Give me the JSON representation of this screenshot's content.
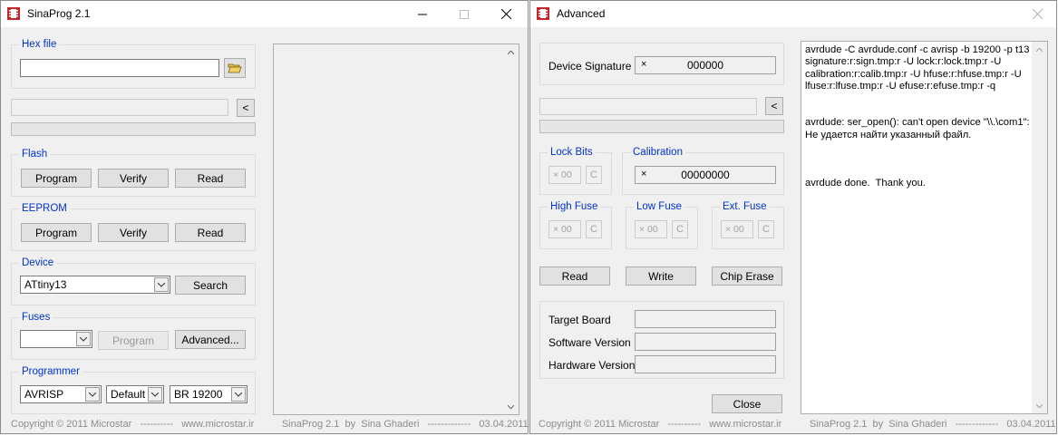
{
  "main_window": {
    "title": "SinaProg 2.1",
    "hex_file": {
      "label": "Hex file",
      "value": ""
    },
    "collapse_button": "<",
    "flash": {
      "label": "Flash",
      "program": "Program",
      "verify": "Verify",
      "read": "Read"
    },
    "eeprom": {
      "label": "EEPROM",
      "program": "Program",
      "verify": "Verify",
      "read": "Read"
    },
    "device": {
      "label": "Device",
      "selected": "ATtiny13",
      "search": "Search"
    },
    "fuses": {
      "label": "Fuses",
      "selected": "",
      "program": "Program",
      "advanced": "Advanced..."
    },
    "programmer": {
      "label": "Programmer",
      "type": "AVRISP",
      "port": "Default",
      "baud": "BR 19200"
    },
    "footer": "Copyright © 2011 Microstar   ----------   www.microstar.ir          SinaProg 2.1  by  Sina Ghaderi   -------------   03.04.2011"
  },
  "advanced_window": {
    "title": "Advanced",
    "device_signature": {
      "label": "Device Signature",
      "x": "×",
      "value": "000000"
    },
    "collapse_button": "<",
    "lock_bits": {
      "label": "Lock Bits",
      "value": "× 00",
      "c": "C"
    },
    "calibration": {
      "label": "Calibration",
      "x": "×",
      "value": "00000000"
    },
    "high_fuse": {
      "label": "High Fuse",
      "value": "× 00",
      "c": "C"
    },
    "low_fuse": {
      "label": "Low Fuse",
      "value": "× 00",
      "c": "C"
    },
    "ext_fuse": {
      "label": "Ext. Fuse",
      "value": "× 00",
      "c": "C"
    },
    "read": "Read",
    "write": "Write",
    "chip_erase": "Chip Erase",
    "target_board": {
      "label": "Target Board",
      "value": ""
    },
    "software_version": {
      "label": "Software Version",
      "value": ""
    },
    "hardware_version": {
      "label": "Hardware Version",
      "value": ""
    },
    "close": "Close",
    "log": "avrdude -C avrdude.conf -c avrisp -b 19200 -p t13 -U signature:r:sign.tmp:r -U lock:r:lock.tmp:r -U calibration:r:calib.tmp:r -U hfuse:r:hfuse.tmp:r -U lfuse:r:lfuse.tmp:r -U efuse:r:efuse.tmp:r -q\n\n\navrdude: ser_open(): can't open device \"\\\\.\\com1\": Не удается найти указанный файл.\n\n\n\navrdude done.  Thank you.",
    "footer": "Copyright © 2011 Microstar   ----------   www.microstar.ir          SinaProg 2.1  by  Sina Ghaderi   -------------   03.04.2011"
  },
  "colors": {
    "group_label": "#0033cc",
    "window_bg": "#f0f0f0",
    "chip_icon": "#c0282d"
  }
}
